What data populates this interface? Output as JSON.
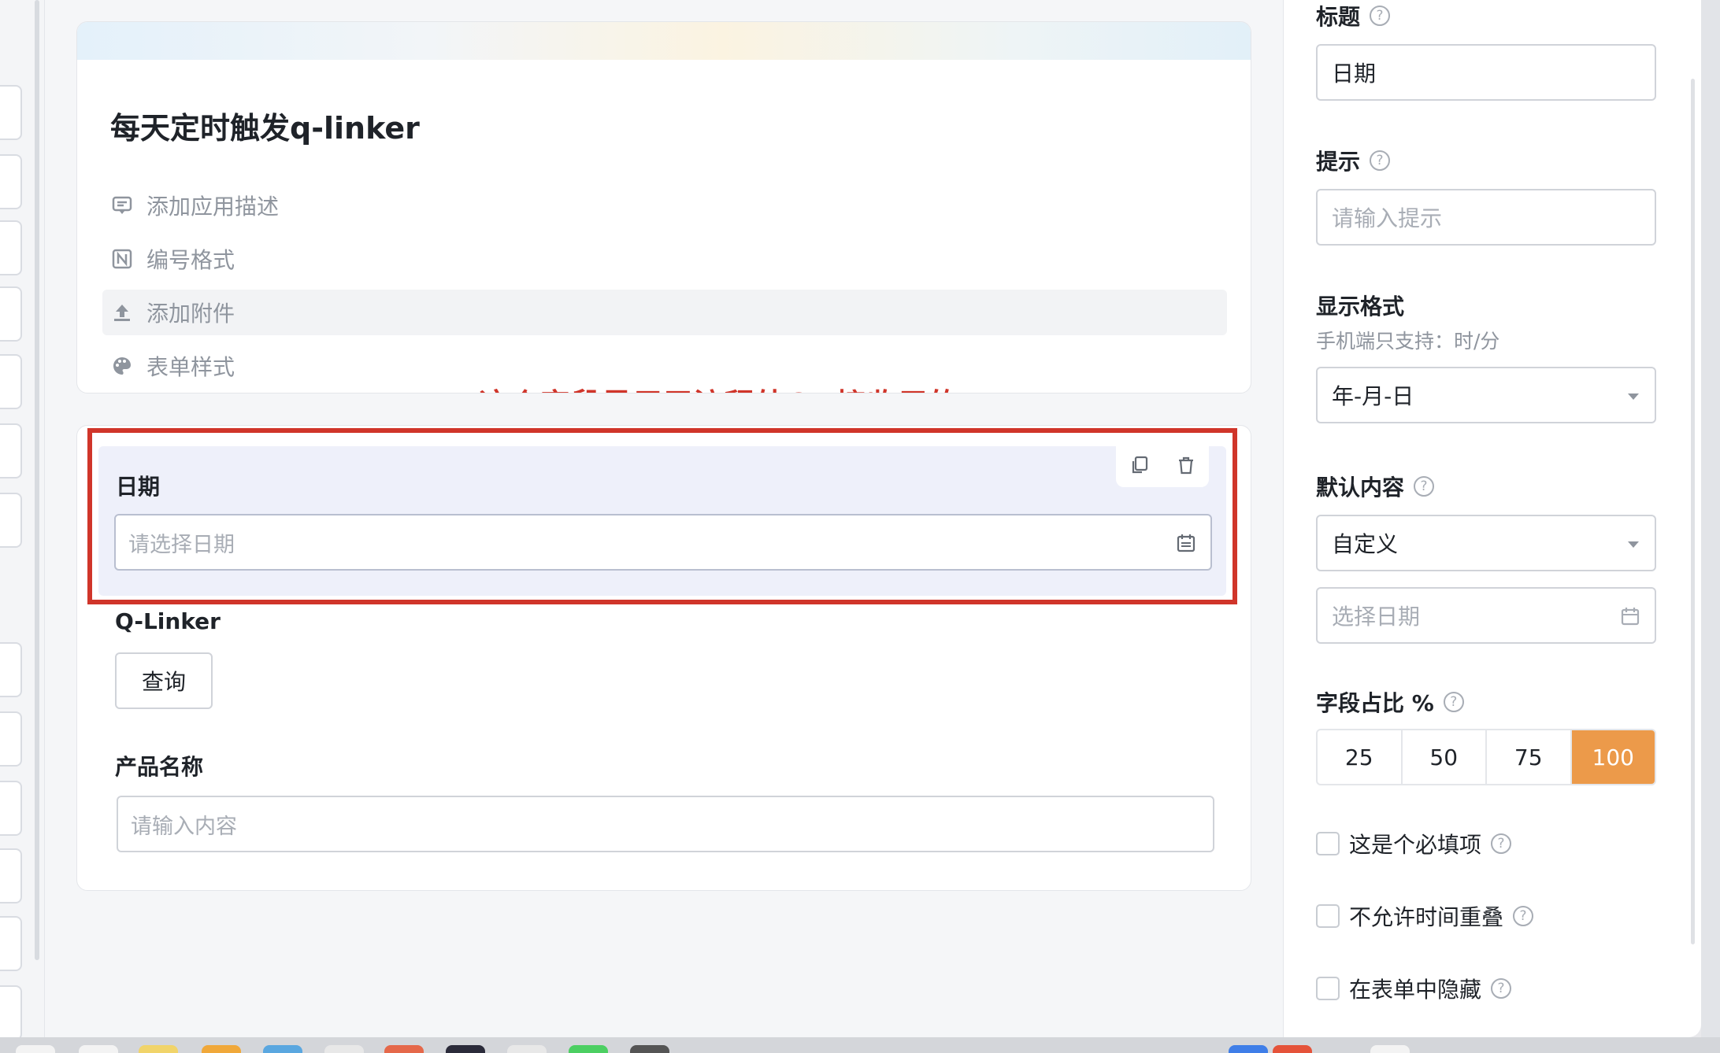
{
  "form": {
    "title": "每天定时触发q-linker",
    "meta_items": [
      {
        "label": "添加应用描述",
        "icon": "comment-icon"
      },
      {
        "label": "编号格式",
        "icon": "numbering-icon"
      },
      {
        "label": "添加附件",
        "icon": "upload-icon"
      },
      {
        "label": "表单样式",
        "icon": "palette-icon"
      }
    ],
    "annotation": "这个字段是用于流程外QR接收用的"
  },
  "fields": {
    "date_field": {
      "label": "日期",
      "placeholder": "请选择日期"
    },
    "qlinker_field": {
      "label": "Q-Linker",
      "button": "查询"
    },
    "product_field": {
      "label": "产品名称",
      "placeholder": "请输入内容"
    }
  },
  "panel": {
    "title_label": "标题",
    "title_value": "日期",
    "hint_label": "提示",
    "hint_placeholder": "请输入提示",
    "format_label": "显示格式",
    "format_sub": "手机端只支持：时/分",
    "format_value": "年-月-日",
    "default_label": "默认内容",
    "default_value": "自定义",
    "default_date_placeholder": "选择日期",
    "ratio_label": "字段占比 %",
    "ratio_options": [
      "25",
      "50",
      "75",
      "100"
    ],
    "ratio_selected": "100",
    "checks": [
      "这是个必填项",
      "不允许时间重叠",
      "在表单中隐藏"
    ]
  },
  "colors": {
    "accent": "#ec9a4a",
    "annotation": "#d0352a",
    "selected_bg": "#eef0fa"
  }
}
